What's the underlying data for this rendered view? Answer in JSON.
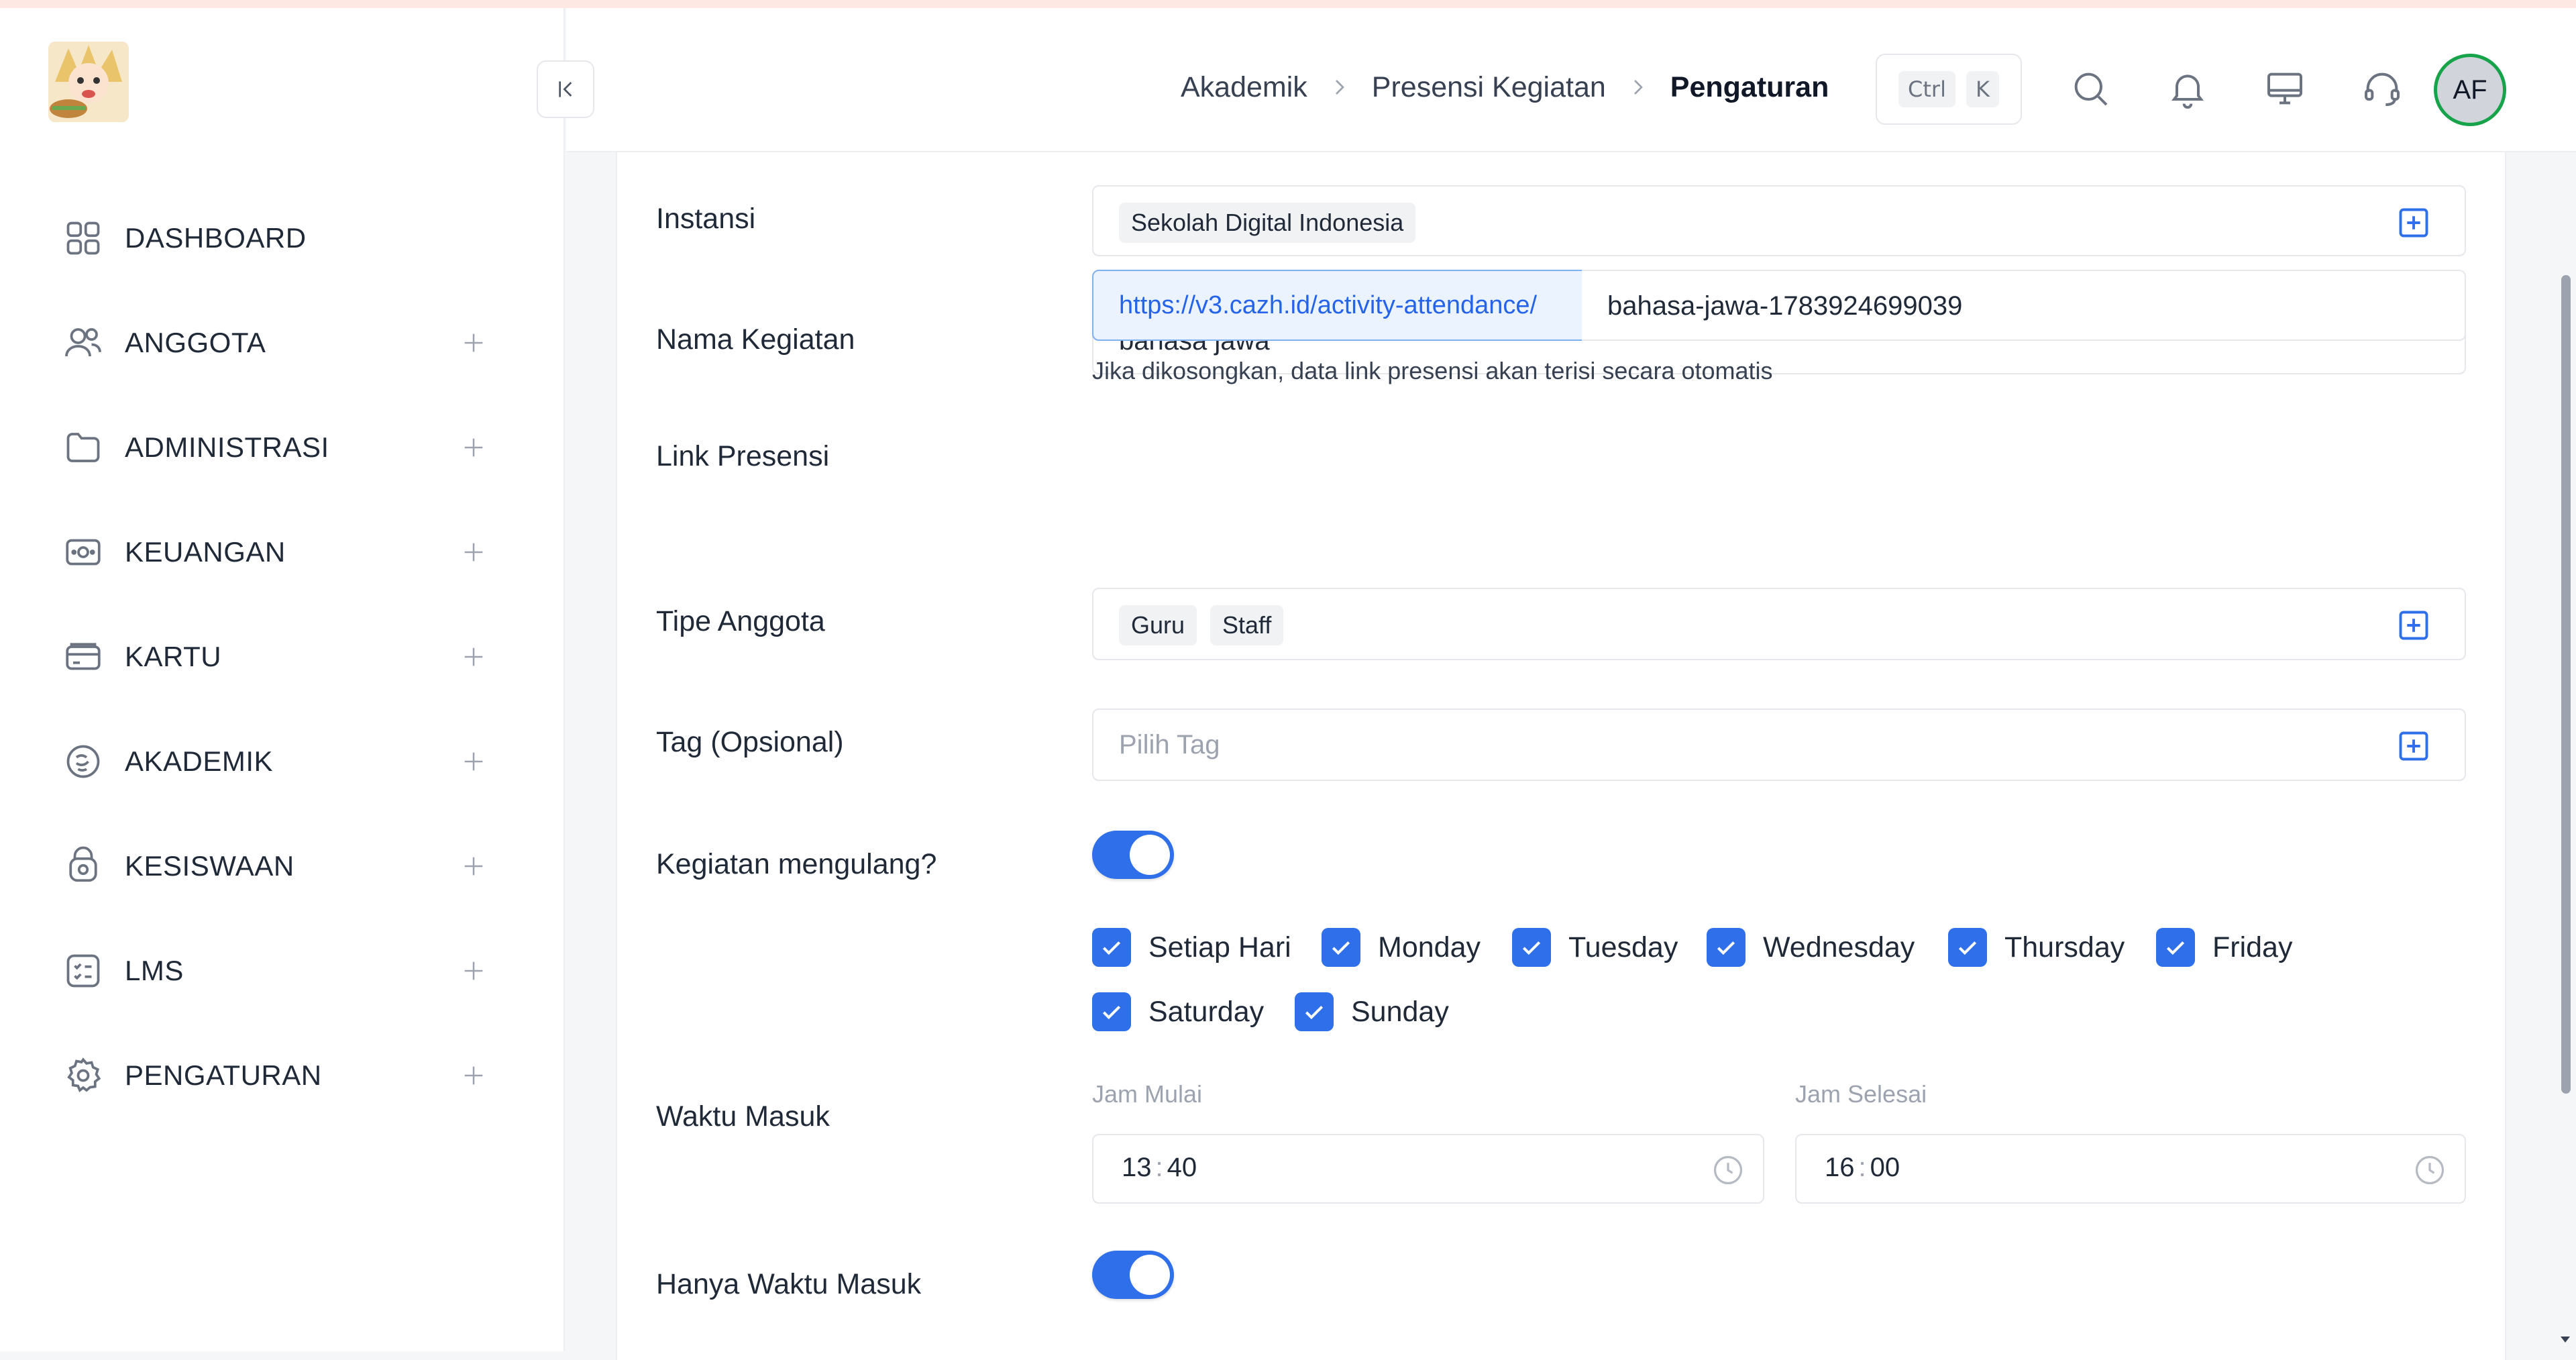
{
  "sidebar": {
    "items": [
      {
        "label": "DASHBOARD",
        "icon": "dashboard-grid-icon",
        "expandable": false
      },
      {
        "label": "ANGGOTA",
        "icon": "users-icon",
        "expandable": true
      },
      {
        "label": "ADMINISTRASI",
        "icon": "folder-icon",
        "expandable": true
      },
      {
        "label": "KEUANGAN",
        "icon": "money-icon",
        "expandable": true
      },
      {
        "label": "KARTU",
        "icon": "card-icon",
        "expandable": true
      },
      {
        "label": "AKADEMIK",
        "icon": "academic-icon",
        "expandable": true
      },
      {
        "label": "KESISWAAN",
        "icon": "student-icon",
        "expandable": true
      },
      {
        "label": "LMS",
        "icon": "checklist-icon",
        "expandable": true
      },
      {
        "label": "PENGATURAN",
        "icon": "gear-icon",
        "expandable": true
      }
    ]
  },
  "header": {
    "breadcrumb": [
      "Akademik",
      "Presensi Kegiatan",
      "Pengaturan"
    ],
    "shortcut": {
      "ctrl": "Ctrl",
      "key": "K"
    },
    "avatar_initials": "AF",
    "icons": [
      "search-icon",
      "bell-icon",
      "monitor-icon",
      "headset-icon"
    ]
  },
  "form": {
    "instansi": {
      "label": "Instansi",
      "tags": [
        "Sekolah Digital Indonesia"
      ]
    },
    "nama_kegiatan": {
      "label": "Nama Kegiatan",
      "value": "bahasa jawa"
    },
    "link_presensi": {
      "label": "Link Presensi",
      "prefix": "https://v3.cazh.id/activity-attendance/",
      "value": "bahasa-jawa-1783924699039",
      "hint": "Jika dikosongkan, data link presensi akan terisi secara otomatis"
    },
    "tipe_anggota": {
      "label": "Tipe Anggota",
      "tags": [
        "Guru",
        "Staff"
      ]
    },
    "tag": {
      "label": "Tag (Opsional)",
      "placeholder": "Pilih Tag"
    },
    "kegiatan_mengulang": {
      "label": "Kegiatan mengulang?",
      "enabled": true
    },
    "days": [
      {
        "label": "Setiap Hari",
        "checked": true
      },
      {
        "label": "Monday",
        "checked": true
      },
      {
        "label": "Tuesday",
        "checked": true
      },
      {
        "label": "Wednesday",
        "checked": true
      },
      {
        "label": "Thursday",
        "checked": true
      },
      {
        "label": "Friday",
        "checked": true
      },
      {
        "label": "Saturday",
        "checked": true
      },
      {
        "label": "Sunday",
        "checked": true
      }
    ],
    "waktu_masuk": {
      "label": "Waktu Masuk",
      "start_label": "Jam Mulai",
      "start_hour": "13",
      "start_min": "40",
      "end_label": "Jam Selesai",
      "end_hour": "16",
      "end_min": "00"
    },
    "hanya_waktu_masuk": {
      "label": "Hanya Waktu Masuk",
      "enabled": true
    }
  },
  "colors": {
    "accent": "#2f6fea",
    "avatar_ring": "#16a34a"
  }
}
